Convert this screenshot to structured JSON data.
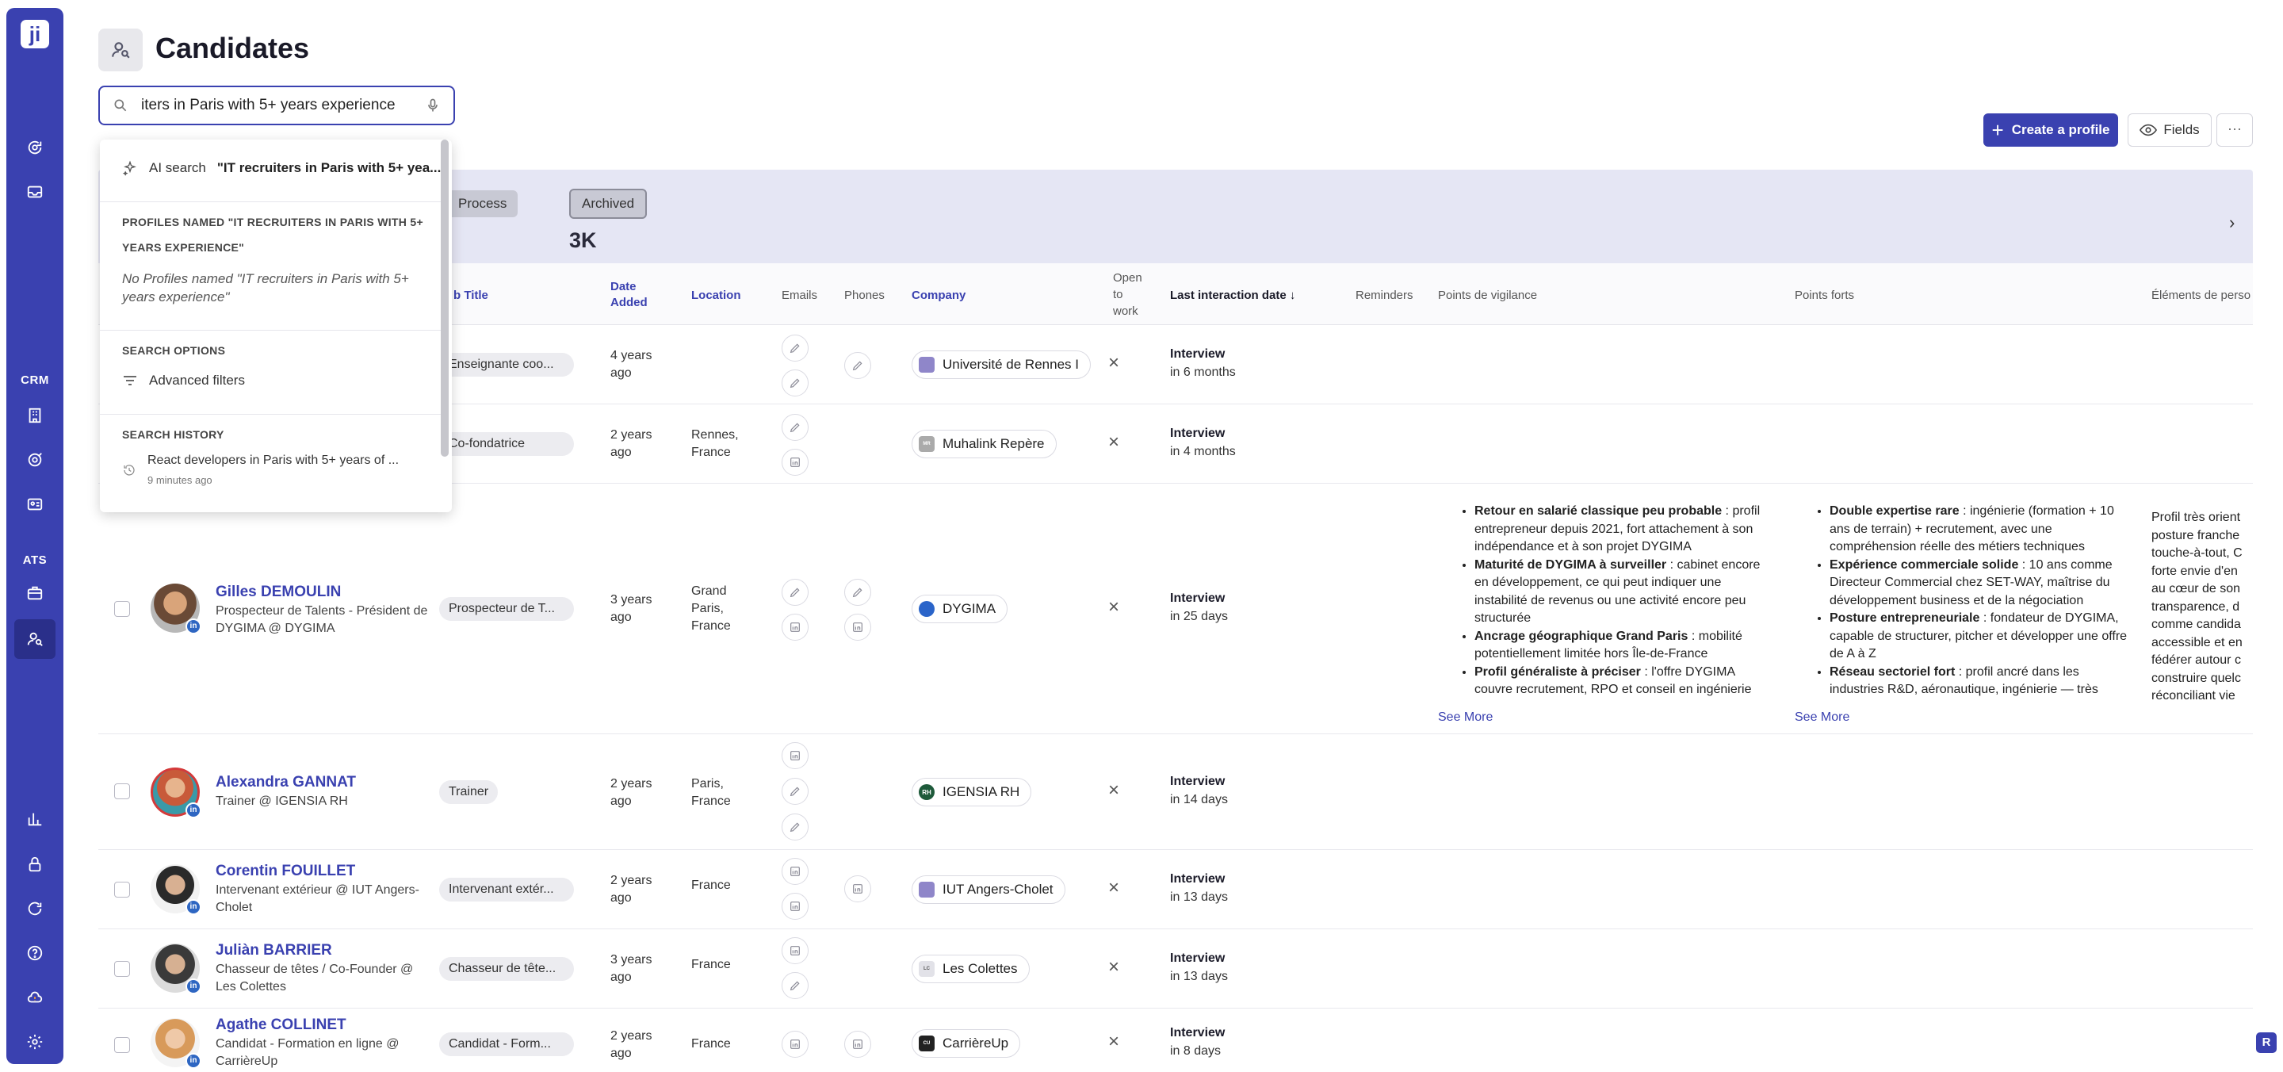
{
  "sidebar": {
    "logo": "ji",
    "crm_label": "CRM",
    "ats_label": "ATS"
  },
  "header": {
    "title": "Candidates"
  },
  "search": {
    "value": "iters in Paris with 5+ years experience"
  },
  "toolbar": {
    "create_label": "Create a profile",
    "fields_label": "Fields",
    "more_label": "···"
  },
  "banner": {
    "process_label": "Process",
    "archived_label": "Archived",
    "archived_count": "3K"
  },
  "dropdown": {
    "ai_prefix": "AI search",
    "ai_query": "\"IT recruiters in Paris with 5+ yea...",
    "profiles_heading": "PROFILES NAMED \"IT RECRUITERS IN PARIS WITH 5+ YEARS EXPERIENCE\"",
    "profiles_empty": "No Profiles named \"IT recruiters in Paris with 5+ years experience\"",
    "options_heading": "SEARCH OPTIONS",
    "advanced_filters": "Advanced filters",
    "history_heading": "SEARCH HISTORY",
    "history_item": "React developers in Paris with 5+ years of ...",
    "history_time": "9 minutes ago"
  },
  "columns": {
    "job_title": "b Title",
    "date_added": "Date Added",
    "location": "Location",
    "emails": "Emails",
    "phones": "Phones",
    "company": "Company",
    "open_to_work": "Open to work",
    "last_interaction": "Last interaction date ↓",
    "reminders": "Reminders",
    "vigilance": "Points de vigilance",
    "forts": "Points forts",
    "elements": "Éléments de perso"
  },
  "rows": [
    {
      "name": "",
      "headline": "",
      "job": "Enseignante coo...",
      "date": "4 years ago",
      "location": "",
      "company": "Université de Rennes I",
      "interaction": "Interview",
      "when": "in 6 months"
    },
    {
      "name": "",
      "headline": "",
      "job": "Co-fondatrice",
      "date": "2 years ago",
      "location": "Rennes, France",
      "company": "Muhalink Repère",
      "interaction": "Interview",
      "when": "in 4 months"
    },
    {
      "name": "Gilles DEMOULIN",
      "headline": "Prospecteur de Talents - Président de DYGIMA @ DYGIMA",
      "job": "Prospecteur de T...",
      "date": "3 years ago",
      "location": "Grand Paris, France",
      "company": "DYGIMA",
      "interaction": "Interview",
      "when": "in 25 days"
    },
    {
      "name": "Alexandra GANNAT",
      "headline": "Trainer @ IGENSIA RH",
      "job": "Trainer",
      "date": "2 years ago",
      "location": "Paris, France",
      "company": "IGENSIA RH",
      "interaction": "Interview",
      "when": "in 14 days"
    },
    {
      "name": "Corentin FOUILLET",
      "headline": "Intervenant extérieur @ IUT Angers-Cholet",
      "job": "Intervenant extér...",
      "date": "2 years ago",
      "location": "France",
      "company": "IUT Angers-Cholet",
      "interaction": "Interview",
      "when": "in 13 days"
    },
    {
      "name": "Juliàn BARRIER",
      "headline": "Chasseur de têtes / Co-Founder @ Les Colettes",
      "job": "Chasseur de tête...",
      "date": "3 years ago",
      "location": "France",
      "company": "Les Colettes",
      "interaction": "Interview",
      "when": "in 13 days"
    },
    {
      "name": "Agathe COLLINET",
      "headline": "Candidat - Formation en ligne @ CarrièreUp",
      "job": "Candidat - Form...",
      "date": "2 years ago",
      "location": "France",
      "company": "CarrièreUp",
      "interaction": "Interview",
      "when": "in 8 days"
    }
  ],
  "gilles_details": {
    "vigilance": [
      {
        "bold": "Retour en salarié classique peu probable",
        "text": " : profil entrepreneur depuis 2021, fort attachement à son indépendance et à son projet DYGIMA"
      },
      {
        "bold": "Maturité de DYGIMA à surveiller",
        "text": " : cabinet encore en développement, ce qui peut indiquer une instabilité de revenus ou une activité encore peu structurée"
      },
      {
        "bold": "Ancrage géographique Grand Paris",
        "text": " : mobilité potentiellement limitée hors Île-de-France"
      },
      {
        "bold": "Profil généraliste à préciser",
        "text": " : l'offre DYGIMA couvre recrutement, RPO et conseil en ingénierie"
      }
    ],
    "forts": [
      {
        "bold": "Double expertise rare",
        "text": " : ingénierie (formation + 10 ans de terrain) + recrutement, avec une compréhension réelle des métiers techniques"
      },
      {
        "bold": "Expérience commerciale solide",
        "text": " : 10 ans comme Directeur Commercial chez SET-WAY, maîtrise du développement business et de la négociation"
      },
      {
        "bold": "Posture entrepreneuriale",
        "text": " : fondateur de DYGIMA, capable de structurer, pitcher et développer une offre de A à Z"
      },
      {
        "bold": "Réseau sectoriel fort",
        "text": " : profil ancré dans les industries R&D, aéronautique, ingénierie — très"
      }
    ],
    "elements_lines": [
      "Profil très orient",
      "posture franche",
      "touche-à-tout, C",
      "forte envie d'en",
      "au cœur de son",
      "transparence, d",
      "comme candida",
      "accessible et en",
      "fédérer autour c",
      "construire quelc",
      "réconciliant vie"
    ],
    "see_more": "See More"
  },
  "help_label": "R"
}
